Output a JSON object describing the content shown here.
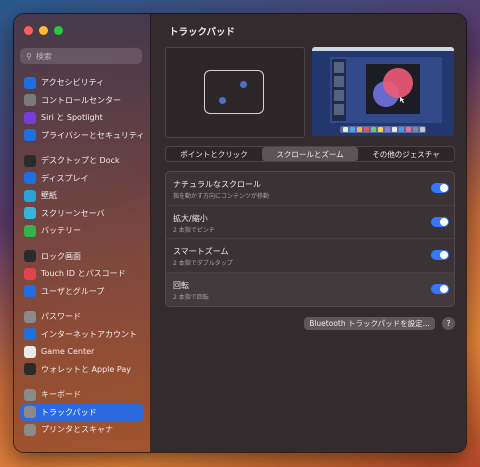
{
  "search": {
    "placeholder": "検索"
  },
  "sidebar": {
    "groups": [
      [
        {
          "label": "アクセシビリティ",
          "icon": "accessibility-icon",
          "color": "#1f6fe0"
        },
        {
          "label": "コントロールセンター",
          "icon": "control-center-icon",
          "color": "#7a7a7a"
        },
        {
          "label": "Siri と Spotlight",
          "icon": "siri-icon",
          "color": "#7a3bd6"
        },
        {
          "label": "プライバシーとセキュリティ",
          "icon": "hand-icon",
          "color": "#1f6fe0"
        }
      ],
      [
        {
          "label": "デスクトップと Dock",
          "icon": "dock-icon",
          "color": "#2b2b2b"
        },
        {
          "label": "ディスプレイ",
          "icon": "display-icon",
          "color": "#1f6fe0"
        },
        {
          "label": "壁紙",
          "icon": "wallpaper-icon",
          "color": "#2aa4d8"
        },
        {
          "label": "スクリーンセーバ",
          "icon": "screensaver-icon",
          "color": "#36b5d9"
        },
        {
          "label": "バッテリー",
          "icon": "battery-icon",
          "color": "#35b24a"
        }
      ],
      [
        {
          "label": "ロック画面",
          "icon": "lock-screen-icon",
          "color": "#2b2b2b"
        },
        {
          "label": "Touch ID とパスコード",
          "icon": "fingerprint-icon",
          "color": "#e2434d"
        },
        {
          "label": "ユーザとグループ",
          "icon": "users-icon",
          "color": "#1f6fe0"
        }
      ],
      [
        {
          "label": "パスワード",
          "icon": "key-icon",
          "color": "#8a8a8a"
        },
        {
          "label": "インターネットアカウント",
          "icon": "at-icon",
          "color": "#1f6fe0"
        },
        {
          "label": "Game Center",
          "icon": "game-center-icon",
          "color": "#e9e9e9"
        },
        {
          "label": "ウォレットと Apple Pay",
          "icon": "wallet-icon",
          "color": "#2b2b2b"
        }
      ],
      [
        {
          "label": "キーボード",
          "icon": "keyboard-icon",
          "color": "#8a8a8a"
        },
        {
          "label": "トラックパッド",
          "icon": "trackpad-icon",
          "color": "#8a8a8a",
          "active": true
        },
        {
          "label": "プリンタとスキャナ",
          "icon": "printer-icon",
          "color": "#8a8a8a"
        }
      ]
    ]
  },
  "main": {
    "title": "トラックパッド",
    "tabs": [
      {
        "label": "ポイントとクリック",
        "selected": false
      },
      {
        "label": "スクロールとズーム",
        "selected": true
      },
      {
        "label": "その他のジェスチャ",
        "selected": false
      }
    ],
    "settings": [
      {
        "label": "ナチュラルなスクロール",
        "sublabel": "指を動かす方向にコンテンツが移動",
        "on": true
      },
      {
        "label": "拡大/縮小",
        "sublabel": "2 本指でピンチ",
        "on": true
      },
      {
        "label": "スマートズーム",
        "sublabel": "2 本指でダブルタップ",
        "on": true
      },
      {
        "label": "回転",
        "sublabel": "2 本指で回転",
        "on": true
      }
    ],
    "bluetooth_button": "Bluetooth トラックパッドを設定...",
    "help_button": "?"
  },
  "colors": {
    "accent": "#3478f6",
    "selected_sidebar": "#2d6ae0"
  }
}
